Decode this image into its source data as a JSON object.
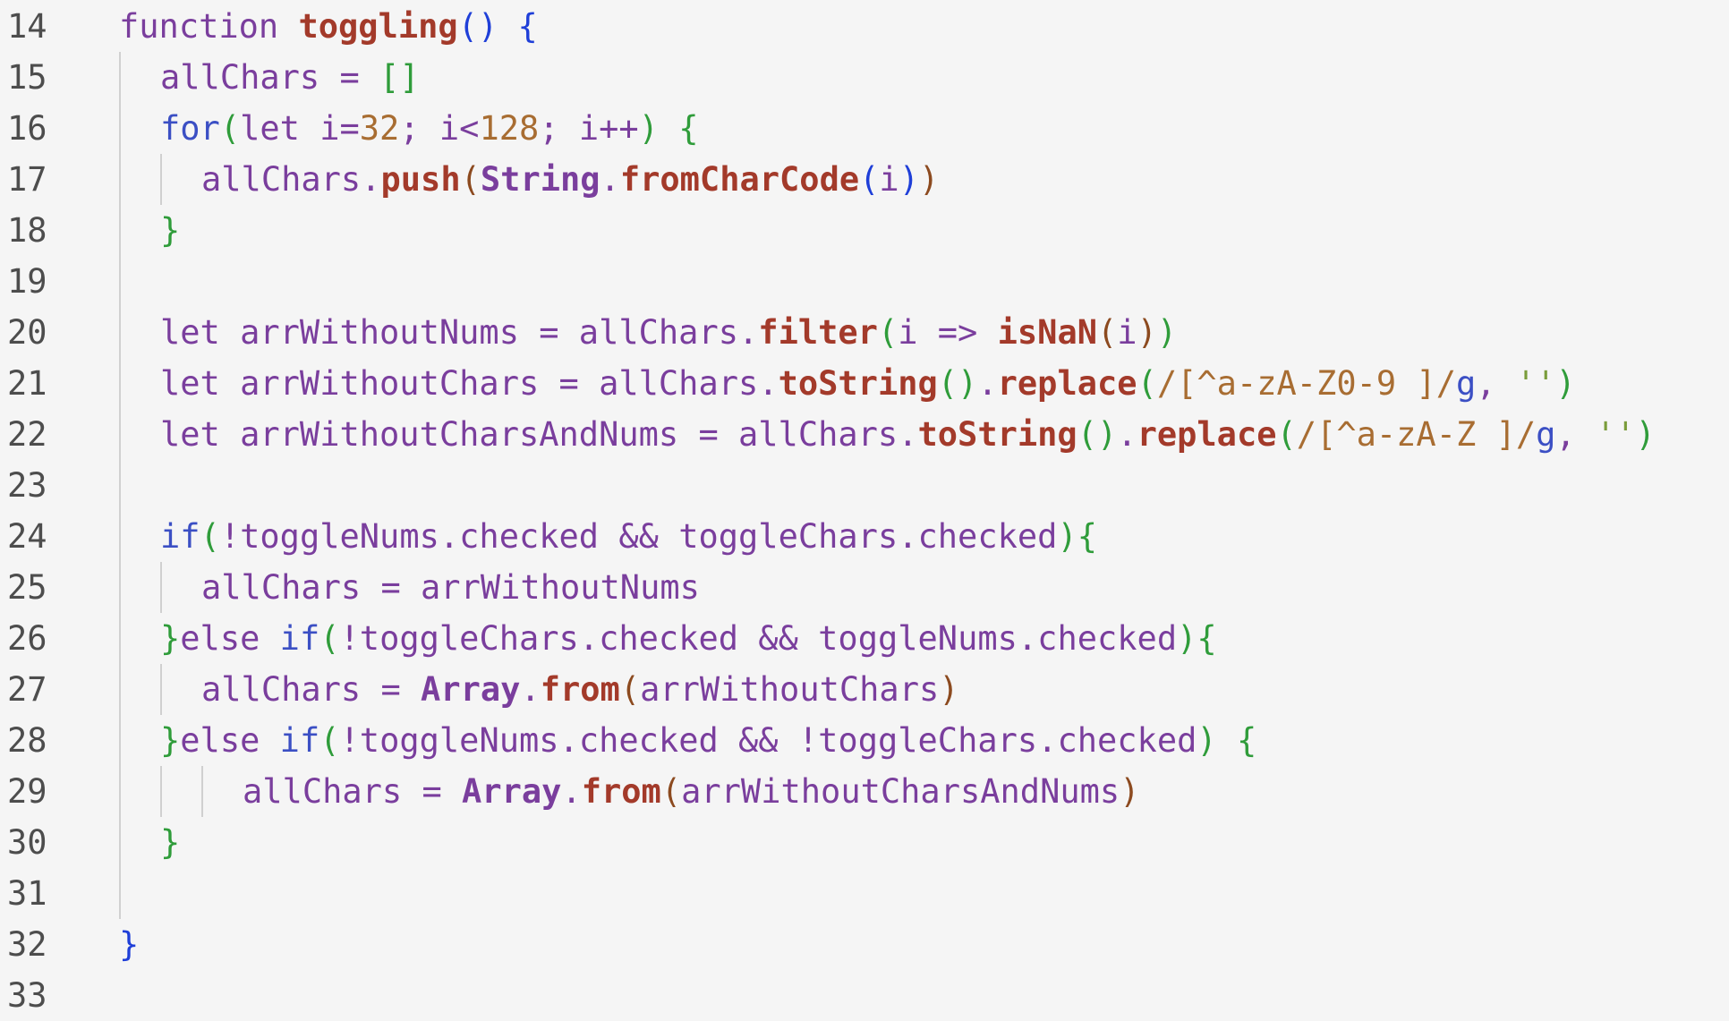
{
  "colors": {
    "background": "#f5f5f5",
    "line_number": "#4d4d4d",
    "keyword": "#7a3e9d",
    "identifier": "#7a3e9d",
    "function_name": "#a33a2a",
    "builtin": "#7a3e9d",
    "number": "#a86d32",
    "string": "#7a9c3a",
    "regex": "#a86d32",
    "bracket_blue": "#1f3fd8",
    "bracket_green": "#2f9c3a",
    "bracket_brown": "#8c4a1f",
    "operator": "#7a3e9d",
    "punct": "#7a3e9d",
    "indent_guide": "#d0d0d0"
  },
  "lines": [
    {
      "num": "14",
      "indent": 0,
      "guides": 0,
      "tokens": [
        {
          "t": "function ",
          "c": "keyword"
        },
        {
          "t": "toggling",
          "c": "function_name",
          "b": true
        },
        {
          "t": "()",
          "c": "bracket_blue"
        },
        {
          "t": " ",
          "c": "punct"
        },
        {
          "t": "{",
          "c": "bracket_blue"
        }
      ]
    },
    {
      "num": "15",
      "indent": 1,
      "guides": 1,
      "tokens": [
        {
          "t": "allChars",
          "c": "identifier"
        },
        {
          "t": " = ",
          "c": "operator"
        },
        {
          "t": "[]",
          "c": "bracket_green"
        }
      ]
    },
    {
      "num": "16",
      "indent": 1,
      "guides": 1,
      "tokens": [
        {
          "t": "for",
          "c": "keyword_blue"
        },
        {
          "t": "(",
          "c": "bracket_green"
        },
        {
          "t": "let i=",
          "c": "identifier"
        },
        {
          "t": "32",
          "c": "number"
        },
        {
          "t": "; i<",
          "c": "identifier"
        },
        {
          "t": "128",
          "c": "number"
        },
        {
          "t": "; i++",
          "c": "identifier"
        },
        {
          "t": ")",
          "c": "bracket_green"
        },
        {
          "t": " ",
          "c": "punct"
        },
        {
          "t": "{",
          "c": "bracket_green"
        }
      ]
    },
    {
      "num": "17",
      "indent": 2,
      "guides": 2,
      "tokens": [
        {
          "t": "allChars",
          "c": "identifier"
        },
        {
          "t": ".",
          "c": "punct"
        },
        {
          "t": "push",
          "c": "function_name",
          "b": true
        },
        {
          "t": "(",
          "c": "bracket_brown"
        },
        {
          "t": "String",
          "c": "builtin",
          "b": true
        },
        {
          "t": ".",
          "c": "punct"
        },
        {
          "t": "fromCharCode",
          "c": "function_name",
          "b": true
        },
        {
          "t": "(",
          "c": "bracket_blue"
        },
        {
          "t": "i",
          "c": "identifier"
        },
        {
          "t": ")",
          "c": "bracket_blue"
        },
        {
          "t": ")",
          "c": "bracket_brown"
        }
      ]
    },
    {
      "num": "18",
      "indent": 1,
      "guides": 1,
      "tokens": [
        {
          "t": "}",
          "c": "bracket_green"
        }
      ]
    },
    {
      "num": "19",
      "indent": 0,
      "guides": 1,
      "tokens": []
    },
    {
      "num": "20",
      "indent": 1,
      "guides": 1,
      "tokens": [
        {
          "t": "let arrWithoutNums = allChars",
          "c": "identifier"
        },
        {
          "t": ".",
          "c": "punct"
        },
        {
          "t": "filter",
          "c": "function_name",
          "b": true
        },
        {
          "t": "(",
          "c": "bracket_green"
        },
        {
          "t": "i => ",
          "c": "identifier"
        },
        {
          "t": "isNaN",
          "c": "function_name",
          "b": true
        },
        {
          "t": "(",
          "c": "bracket_brown"
        },
        {
          "t": "i",
          "c": "identifier"
        },
        {
          "t": ")",
          "c": "bracket_brown"
        },
        {
          "t": ")",
          "c": "bracket_green"
        }
      ]
    },
    {
      "num": "21",
      "indent": 1,
      "guides": 1,
      "tokens": [
        {
          "t": "let arrWithoutChars = allChars",
          "c": "identifier"
        },
        {
          "t": ".",
          "c": "punct"
        },
        {
          "t": "toString",
          "c": "function_name",
          "b": true
        },
        {
          "t": "()",
          "c": "bracket_green"
        },
        {
          "t": ".",
          "c": "punct"
        },
        {
          "t": "replace",
          "c": "function_name",
          "b": true
        },
        {
          "t": "(",
          "c": "bracket_green"
        },
        {
          "t": "/[^a-zA-Z0-9 ]/",
          "c": "regex"
        },
        {
          "t": "g",
          "c": "regex_flag"
        },
        {
          "t": ", ",
          "c": "punct"
        },
        {
          "t": "''",
          "c": "string"
        },
        {
          "t": ")",
          "c": "bracket_green"
        }
      ]
    },
    {
      "num": "22",
      "indent": 1,
      "guides": 1,
      "tokens": [
        {
          "t": "let arrWithoutCharsAndNums = allChars",
          "c": "identifier"
        },
        {
          "t": ".",
          "c": "punct"
        },
        {
          "t": "toString",
          "c": "function_name",
          "b": true
        },
        {
          "t": "()",
          "c": "bracket_green"
        },
        {
          "t": ".",
          "c": "punct"
        },
        {
          "t": "replace",
          "c": "function_name",
          "b": true
        },
        {
          "t": "(",
          "c": "bracket_green"
        },
        {
          "t": "/[^a-zA-Z ]/",
          "c": "regex"
        },
        {
          "t": "g",
          "c": "regex_flag"
        },
        {
          "t": ", ",
          "c": "punct"
        },
        {
          "t": "''",
          "c": "string"
        },
        {
          "t": ")",
          "c": "bracket_green"
        }
      ]
    },
    {
      "num": "23",
      "indent": 0,
      "guides": 1,
      "tokens": []
    },
    {
      "num": "24",
      "indent": 1,
      "guides": 1,
      "tokens": [
        {
          "t": "if",
          "c": "keyword_blue"
        },
        {
          "t": "(",
          "c": "bracket_green"
        },
        {
          "t": "!toggleNums.checked && toggleChars.checked",
          "c": "identifier"
        },
        {
          "t": ")",
          "c": "bracket_green"
        },
        {
          "t": "{",
          "c": "bracket_green"
        }
      ]
    },
    {
      "num": "25",
      "indent": 2,
      "guides": 2,
      "tokens": [
        {
          "t": "allChars = arrWithoutNums",
          "c": "identifier"
        }
      ]
    },
    {
      "num": "26",
      "indent": 1,
      "guides": 1,
      "tokens": [
        {
          "t": "}",
          "c": "bracket_green"
        },
        {
          "t": "else ",
          "c": "keyword"
        },
        {
          "t": "if",
          "c": "keyword_blue"
        },
        {
          "t": "(",
          "c": "bracket_green"
        },
        {
          "t": "!toggleChars.checked && toggleNums.checked",
          "c": "identifier"
        },
        {
          "t": ")",
          "c": "bracket_green"
        },
        {
          "t": "{",
          "c": "bracket_green"
        }
      ]
    },
    {
      "num": "27",
      "indent": 2,
      "guides": 2,
      "tokens": [
        {
          "t": "allChars = ",
          "c": "identifier"
        },
        {
          "t": "Array",
          "c": "builtin",
          "b": true
        },
        {
          "t": ".",
          "c": "punct"
        },
        {
          "t": "from",
          "c": "function_name",
          "b": true
        },
        {
          "t": "(",
          "c": "bracket_brown"
        },
        {
          "t": "arrWithoutChars",
          "c": "identifier"
        },
        {
          "t": ")",
          "c": "bracket_brown"
        }
      ]
    },
    {
      "num": "28",
      "indent": 1,
      "guides": 1,
      "tokens": [
        {
          "t": "}",
          "c": "bracket_green"
        },
        {
          "t": "else ",
          "c": "keyword"
        },
        {
          "t": "if",
          "c": "keyword_blue"
        },
        {
          "t": "(",
          "c": "bracket_green"
        },
        {
          "t": "!toggleNums.checked && !toggleChars.checked",
          "c": "identifier"
        },
        {
          "t": ")",
          "c": "bracket_green"
        },
        {
          "t": " ",
          "c": "punct"
        },
        {
          "t": "{",
          "c": "bracket_green"
        }
      ]
    },
    {
      "num": "29",
      "indent": 3,
      "guides": 3,
      "tokens": [
        {
          "t": "allChars = ",
          "c": "identifier"
        },
        {
          "t": "Array",
          "c": "builtin",
          "b": true
        },
        {
          "t": ".",
          "c": "punct"
        },
        {
          "t": "from",
          "c": "function_name",
          "b": true
        },
        {
          "t": "(",
          "c": "bracket_brown"
        },
        {
          "t": "arrWithoutCharsAndNums",
          "c": "identifier"
        },
        {
          "t": ")",
          "c": "bracket_brown"
        }
      ]
    },
    {
      "num": "30",
      "indent": 1,
      "guides": 1,
      "tokens": [
        {
          "t": "}",
          "c": "bracket_green"
        }
      ]
    },
    {
      "num": "31",
      "indent": 0,
      "guides": 1,
      "tokens": []
    },
    {
      "num": "32",
      "indent": 0,
      "guides": 0,
      "tokens": [
        {
          "t": "}",
          "c": "bracket_blue"
        }
      ]
    },
    {
      "num": "33",
      "indent": 0,
      "guides": 0,
      "tokens": []
    }
  ]
}
